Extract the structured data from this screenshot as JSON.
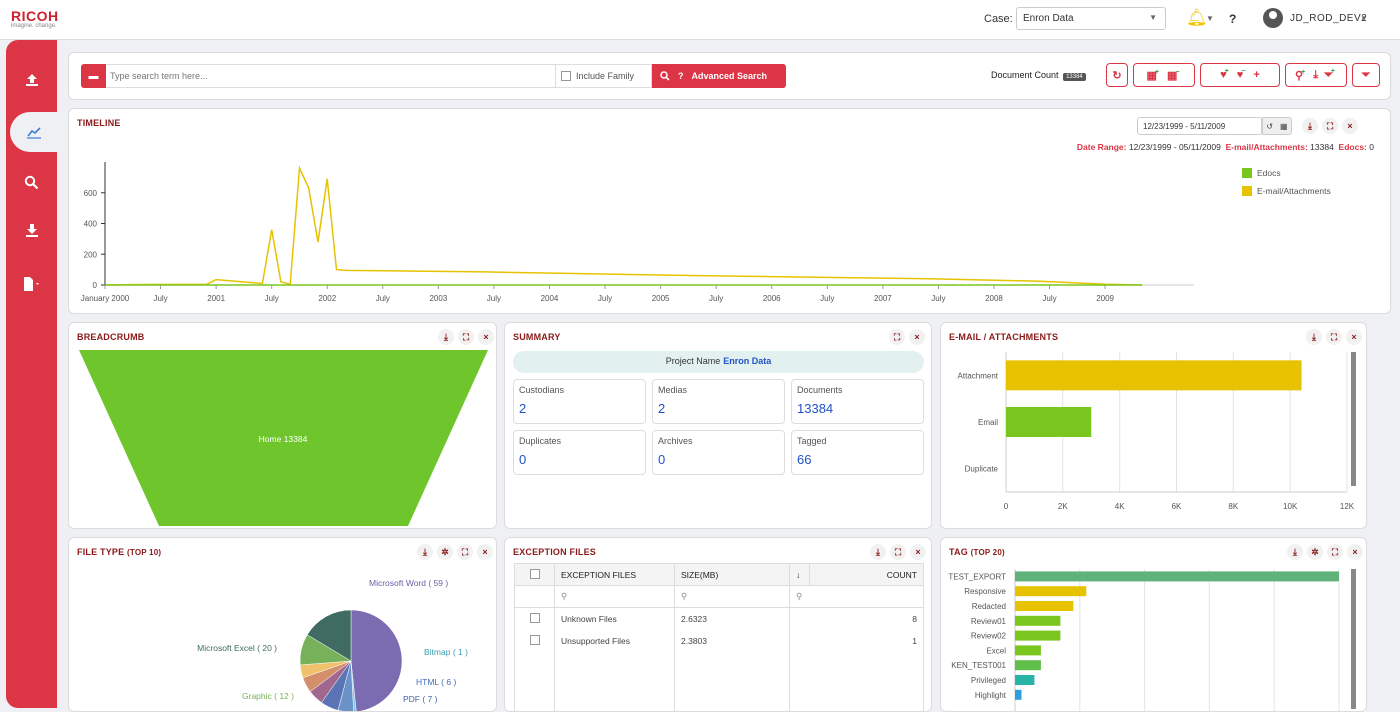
{
  "header": {
    "logo_brand": "RICOH",
    "logo_tagline": "imagine. change.",
    "case_label": "Case:",
    "case_value": "Enron Data",
    "help": "?",
    "user_name": "JD_ROD_DEV2"
  },
  "search": {
    "placeholder": "Type search term here...",
    "include_family": "Include Family",
    "advanced": "Advanced Search",
    "document_count_label": "Document Count",
    "document_count": "13384"
  },
  "timeline": {
    "title": "TIMELINE",
    "date_input": "12/23/1999 - 5/11/2009",
    "range_label": "Date Range:",
    "range_value": "12/23/1999 - 05/11/2009",
    "email_label": "E-mail/Attachments:",
    "email_value": "13384",
    "edocs_label": "Edocs:",
    "edocs_value": "0",
    "legend": [
      {
        "name": "Edocs",
        "color": "#7ac61f"
      },
      {
        "name": "E-mail/Attachments",
        "color": "#e6c200"
      }
    ]
  },
  "breadcrumb": {
    "title": "BREADCRUMB",
    "funnel_label": "Home 13384"
  },
  "summary": {
    "title": "SUMMARY",
    "project_label": "Project Name",
    "project_value": "Enron Data",
    "stats": [
      {
        "label": "Custodians",
        "value": "2"
      },
      {
        "label": "Medias",
        "value": "2"
      },
      {
        "label": "Documents",
        "value": "13384"
      },
      {
        "label": "Duplicates",
        "value": "0"
      },
      {
        "label": "Archives",
        "value": "0"
      },
      {
        "label": "Tagged",
        "value": "66"
      }
    ]
  },
  "email_panel": {
    "title": "E-MAIL / ATTACHMENTS"
  },
  "filetype": {
    "title": "FILE TYPE",
    "title_small": "(TOP 10)"
  },
  "exceptions": {
    "title": "EXCEPTION FILES",
    "columns": [
      "EXCEPTION FILES",
      "SIZE(MB)",
      "↓",
      "COUNT"
    ],
    "rows": [
      {
        "name": "Unknown Files",
        "size": "2.6323",
        "count": "8"
      },
      {
        "name": "Unsupported Files",
        "size": "2.3803",
        "count": "1"
      }
    ]
  },
  "tags": {
    "title": "TAG",
    "title_small": "(TOP 20)"
  },
  "chart_data": [
    {
      "type": "line",
      "name": "timeline",
      "x": [
        "2000-01",
        "2000-03",
        "2000-12",
        "2001-01",
        "2001-06",
        "2001-07",
        "2001-08",
        "2001-09",
        "2001-10",
        "2001-11",
        "2001-12",
        "2002-01",
        "2002-02",
        "2002-03",
        "2003-06",
        "2004-06",
        "2005-06",
        "2006-06",
        "2007-06",
        "2008-06",
        "2009-01",
        "2009-05"
      ],
      "series": [
        {
          "name": "E-mail/Attachments",
          "color": "#e6c200",
          "values": [
            0,
            2,
            5,
            35,
            10,
            360,
            20,
            5,
            760,
            630,
            280,
            690,
            100,
            95,
            85,
            72,
            60,
            50,
            40,
            25,
            5,
            0
          ]
        },
        {
          "name": "Edocs",
          "color": "#7ac61f",
          "values": [
            0,
            0,
            0,
            0,
            0,
            0,
            0,
            0,
            0,
            0,
            0,
            0,
            0,
            0,
            0,
            0,
            0,
            0,
            0,
            0,
            0,
            0
          ]
        }
      ],
      "x_ticks": [
        "January 2000",
        "July",
        "2001",
        "July",
        "2002",
        "July",
        "2003",
        "July",
        "2004",
        "July",
        "2005",
        "July",
        "2006",
        "July",
        "2007",
        "July",
        "2008",
        "July",
        "2009"
      ],
      "ylim": [
        0,
        800
      ],
      "y_ticks": [
        0,
        200,
        400,
        600
      ]
    },
    {
      "type": "funnel",
      "name": "breadcrumb",
      "categories": [
        "Home"
      ],
      "values": [
        13384
      ],
      "color": "#6fc62c"
    },
    {
      "type": "bar",
      "orientation": "horizontal",
      "name": "email_attachments",
      "categories": [
        "Attachment",
        "Email",
        "Duplicate"
      ],
      "values": [
        10400,
        3000,
        0
      ],
      "colors": [
        "#e6c200",
        "#7ac61f",
        "#aaaaaa"
      ],
      "xlim": [
        0,
        12000
      ],
      "x_ticks": [
        "0",
        "2K",
        "4K",
        "6K",
        "8K",
        "10K",
        "12K"
      ]
    },
    {
      "type": "pie",
      "name": "file_type",
      "slices": [
        {
          "label": "Microsoft Word ( 59 )",
          "value": 59,
          "color": "#7b6bb0"
        },
        {
          "label": "Bitmap ( 1 )",
          "value": 1,
          "color": "#7ec8e3"
        },
        {
          "label": "HTML ( 6 )",
          "value": 6,
          "color": "#6a92c9"
        },
        {
          "label": "PDF ( 7 )",
          "value": 7,
          "color": "#5a74b5"
        },
        {
          "label": "",
          "value": 6,
          "color": "#a1678f"
        },
        {
          "label": "",
          "value": 6,
          "color": "#d38e6a"
        },
        {
          "label": "",
          "value": 5,
          "color": "#f0c16a"
        },
        {
          "label": "Graphic ( 12 )",
          "value": 12,
          "color": "#77b25b"
        },
        {
          "label": "Microsoft Excel ( 20 )",
          "value": 20,
          "color": "#3f6b62"
        }
      ],
      "label_colors": {
        "Microsoft Word ( 59 )": "#6b5ea8",
        "Bitmap ( 1 )": "#3a9fb5",
        "HTML ( 6 )": "#3f6fb5",
        "PDF ( 7 )": "#3f5fa5",
        "Graphic ( 12 )": "#77b25b",
        "Microsoft Excel ( 20 )": "#3f6b62"
      }
    },
    {
      "type": "bar",
      "orientation": "horizontal",
      "name": "tags",
      "categories": [
        "TEST_EXPORT",
        "Responsive",
        "Redacted",
        "Review01",
        "Review02",
        "Excel",
        "KEN_TEST001",
        "Privileged",
        "Highlight"
      ],
      "values": [
        100,
        22,
        18,
        14,
        14,
        8,
        8,
        6,
        2
      ],
      "colors": [
        "#5fb37a",
        "#e6c200",
        "#e6c200",
        "#7ac61f",
        "#7ac61f",
        "#7ac61f",
        "#5fbf4a",
        "#2bb3a8",
        "#2b9fe0"
      ],
      "xlim": [
        0,
        100
      ]
    }
  ]
}
